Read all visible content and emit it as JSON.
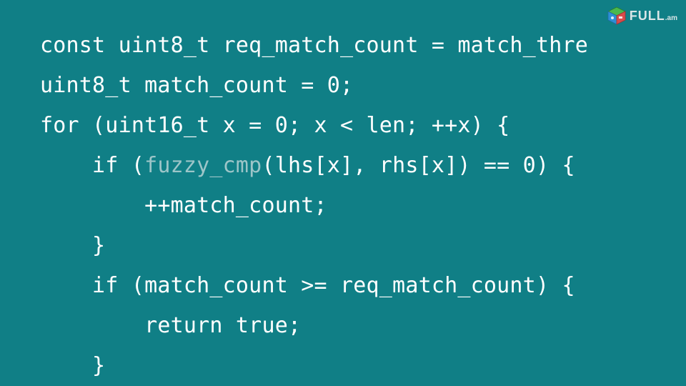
{
  "code": {
    "lines": [
      {
        "segments": [
          {
            "t": "const uint8_t req_match_count = match_thre"
          }
        ]
      },
      {
        "segments": [
          {
            "t": "uint8_t match_count = 0;"
          }
        ]
      },
      {
        "segments": [
          {
            "t": "for (uint16_t x = 0; x < len; ++x) {"
          }
        ]
      },
      {
        "segments": [
          {
            "t": "    if ("
          },
          {
            "t": "fuzzy_cmp",
            "dim": true
          },
          {
            "t": "(lhs[x], rhs[x]) == 0) {"
          }
        ]
      },
      {
        "segments": [
          {
            "t": "        ++match_count;"
          }
        ]
      },
      {
        "segments": [
          {
            "t": "    }"
          }
        ]
      },
      {
        "segments": [
          {
            "t": "    if (match_count >= req_match_count) {"
          }
        ]
      },
      {
        "segments": [
          {
            "t": "        return true;"
          }
        ]
      },
      {
        "segments": [
          {
            "t": "    }"
          }
        ]
      }
    ]
  },
  "logo": {
    "text": "FULL",
    "suffix": ".am"
  }
}
